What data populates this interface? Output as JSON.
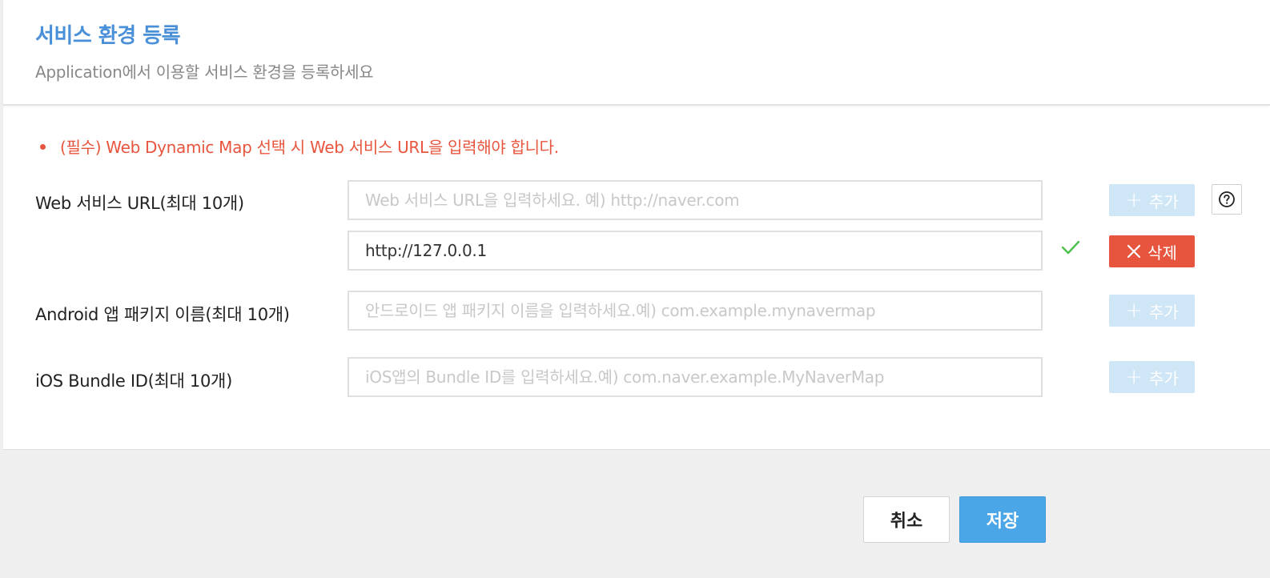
{
  "header": {
    "title": "서비스 환경 등록",
    "subtitle": "Application에서 이용할 서비스 환경을 등록하세요"
  },
  "notice": {
    "text": "(필수) Web Dynamic Map 선택 시 Web 서비스 URL을 입력해야 합니다."
  },
  "web_url": {
    "label": "Web 서비스 URL(최대 10개)",
    "placeholder": "Web 서비스 URL을 입력하세요. 예) http://naver.com",
    "add_label": "추가",
    "entries": [
      {
        "value": "http://127.0.0.1",
        "valid": true,
        "delete_label": "삭제"
      }
    ]
  },
  "android": {
    "label": "Android 앱 패키지 이름(최대 10개)",
    "placeholder": "안드로이드 앱 패키지 이름을 입력하세요.예) com.example.mynavermap",
    "add_label": "추가"
  },
  "ios": {
    "label": "iOS Bundle ID(최대 10개)",
    "placeholder": "iOS앱의 Bundle ID를 입력하세요.예) com.naver.example.MyNaverMap",
    "add_label": "추가"
  },
  "footer": {
    "cancel_label": "취소",
    "save_label": "저장"
  },
  "icons": {
    "help": "question-circle-icon",
    "valid": "check-icon",
    "add": "plus-icon",
    "delete": "close-icon"
  },
  "colors": {
    "title": "#4a90d9",
    "warning": "#e8553e",
    "add_button_disabled": "#cfe6f7",
    "delete_button": "#e8553e",
    "save_button": "#4aa6e6",
    "valid_check": "#4cc04c"
  }
}
